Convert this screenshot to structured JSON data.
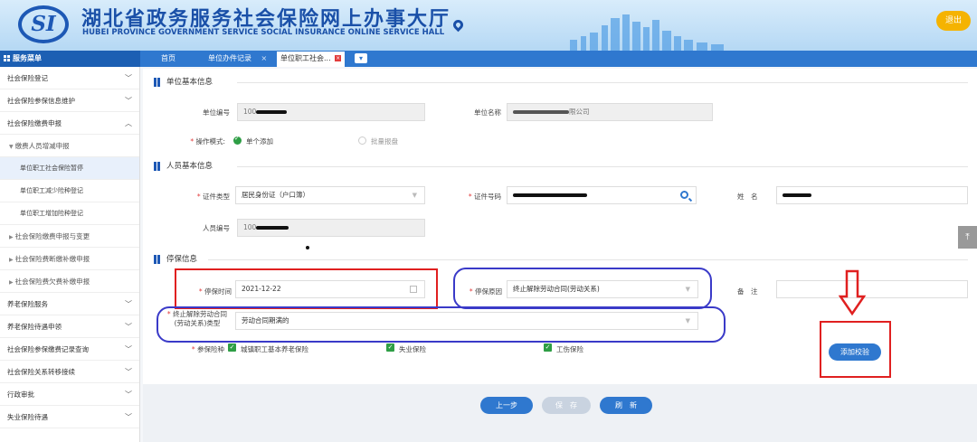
{
  "header": {
    "logo_text": "SI",
    "title": "湖北省政务服务社会保险网上办事大厅",
    "subtitle": "HUBEI PROVINCE GOVERNMENT SERVICE SOCIAL INSURANCE ONLINE SERVICE HALL",
    "exit_label": "退出",
    "pin_icon": "location-pin-icon"
  },
  "nav": {
    "menu_title": "服务菜单",
    "tabs": [
      {
        "label": "首页"
      },
      {
        "label": "单位办件记录"
      },
      {
        "label": "单位职工社会..."
      }
    ],
    "close_symbol": "×"
  },
  "sidebar": {
    "items": [
      {
        "label": "社会保险登记",
        "chevron": "﹀"
      },
      {
        "label": "社会保险参保信息维护",
        "chevron": "﹀"
      },
      {
        "label": "社会保险缴费申报",
        "chevron": "︿"
      },
      {
        "label": "缴费人员增减申报"
      },
      {
        "label": "单位职工社会保险暂停"
      },
      {
        "label": "单位职工减少险种登记"
      },
      {
        "label": "单位职工增加险种登记"
      },
      {
        "label": "社会保险缴费申报与变更"
      },
      {
        "label": "社会保险费断缴补缴申报"
      },
      {
        "label": "社会保险费欠费补缴申报"
      },
      {
        "label": "养老保险服务",
        "chevron": "﹀"
      },
      {
        "label": "养老保险待遇申领",
        "chevron": "﹀"
      },
      {
        "label": "社会保险参保缴费记录查询",
        "chevron": "﹀"
      },
      {
        "label": "社会保险关系转移接续",
        "chevron": "﹀"
      },
      {
        "label": "行政审批",
        "chevron": "﹀"
      },
      {
        "label": "失业保险待遇",
        "chevron": "﹀"
      }
    ]
  },
  "unit_section": {
    "title": "单位基本信息",
    "unit_no_label": "单位编号",
    "unit_no_value": "100",
    "unit_name_label": "单位名称",
    "unit_name_value": "限公司",
    "mode_label": "操作模式:",
    "mode_single": "单个添加",
    "mode_batch": "批量报盘"
  },
  "person_section": {
    "title": "人员基本信息",
    "id_type_label": "证件类型",
    "id_type_value": "居民身份证（户口簿）",
    "id_no_label": "证件号码",
    "name_label": "姓　名",
    "person_no_label": "人员编号",
    "person_no_value": "100"
  },
  "stop_section": {
    "title": "停保信息",
    "stop_date_label": "停保时间",
    "stop_date_value": "2021-12-22",
    "stop_reason_label": "停保原因",
    "stop_reason_value": "终止解除劳动合同(劳动关系)",
    "remark_label": "备　注",
    "terminate_label": "终止解除劳动合同(劳动关系)类型",
    "terminate_value": "劳动合同期满的",
    "insurance_label": "参保险种",
    "insurance_options": [
      "城镇职工基本养老保险",
      "失业保险",
      "工伤保险"
    ],
    "add_check_label": "添加校验"
  },
  "buttons": {
    "prev": "上一步",
    "save": "保　存",
    "refresh": "刷　新"
  },
  "colors": {
    "primary": "#2f78cf",
    "annotation_red": "#e02020",
    "annotation_blue": "#3a3ac8",
    "check_green": "#2e9e45",
    "exit_yellow": "#f5b301"
  }
}
